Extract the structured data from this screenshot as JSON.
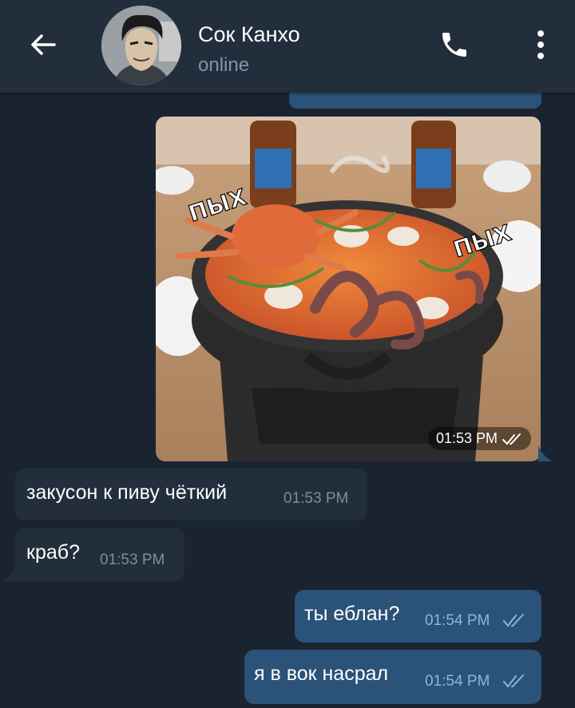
{
  "header": {
    "contact_name": "Сок Канхо",
    "status": "online",
    "icons": {
      "back": "arrow-left-icon",
      "call": "phone-icon",
      "menu": "more-vertical-icon"
    }
  },
  "colors": {
    "header_bg": "#222e3b",
    "chat_bg": "#1a2330",
    "outgoing_bubble": "#2b5278",
    "incoming_bubble": "#222e3b",
    "read_ticks": "#8fb4d6"
  },
  "messages": [
    {
      "type": "photo",
      "direction": "out",
      "time": "01:53 PM",
      "read": true,
      "caption_image_text": [
        "ПЫХ",
        "ПЫХ"
      ]
    },
    {
      "type": "text",
      "direction": "in",
      "text": "закусон к пиву чёткий",
      "time": "01:53 PM"
    },
    {
      "type": "text",
      "direction": "in",
      "text": "краб?",
      "time": "01:53 PM"
    },
    {
      "type": "text",
      "direction": "out",
      "text": "ты еблан?",
      "time": "01:54 PM",
      "read": true
    },
    {
      "type": "text",
      "direction": "out",
      "text": "я в вок насрал",
      "time": "01:54 PM",
      "read": true
    }
  ]
}
